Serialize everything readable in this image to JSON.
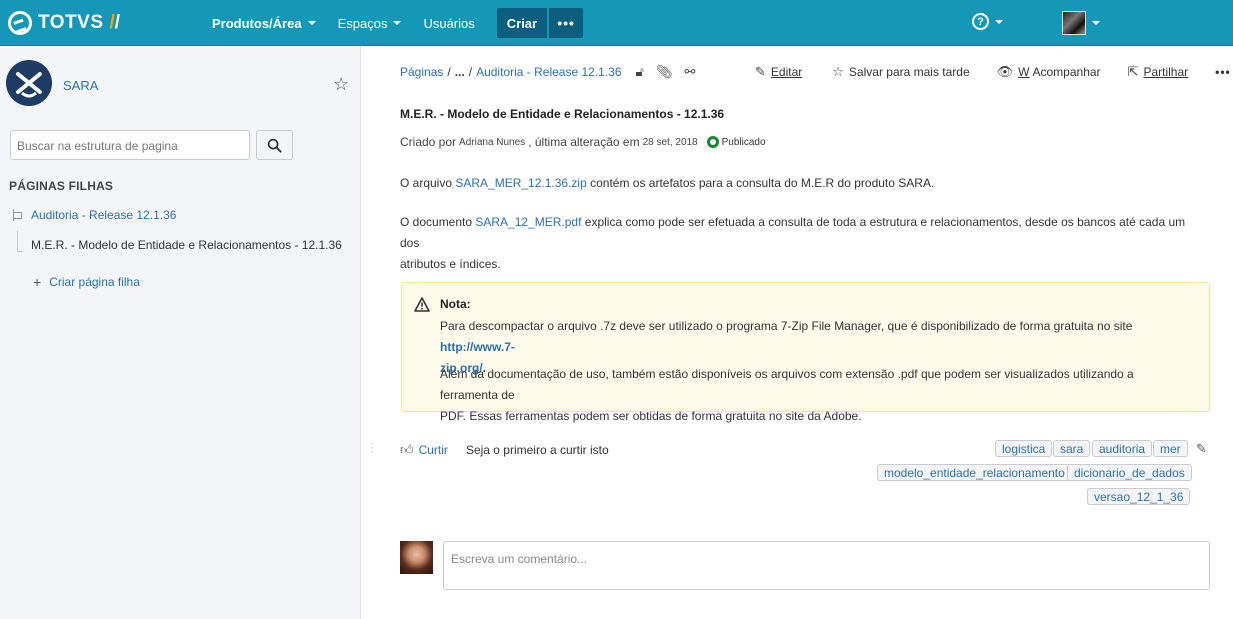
{
  "header": {
    "brand": "TOTVS",
    "brand_slash_1": "/",
    "brand_slash_2": "/",
    "nav": [
      {
        "label": "Produtos/Área"
      },
      {
        "label": "Espaços"
      },
      {
        "label": "Usuários"
      }
    ],
    "create_label": "Criar",
    "more_label": "•••",
    "help_symbol": "?",
    "colors": {
      "topbar": "#1597b8",
      "create": "#0b5e7e",
      "brand_accent": "#f7a600"
    }
  },
  "sidebar": {
    "space_name": "SARA",
    "search_placeholder": "Buscar na estrutura de pagina",
    "child_pages_heading": "PÁGINAS FILHAS",
    "parent_page": "Auditoria - Release 12.1.36",
    "current_page": "M.E.R. - Modelo de Entidade e Relacionamentos - 12.1.36",
    "create_child_label": "Criar página filha"
  },
  "breadcrumb": {
    "root": "Páginas",
    "ellipsis": "...",
    "parent": "Auditoria - Release 12.1.36"
  },
  "actions": {
    "edit": "Editar",
    "save_later": "Salvar para mais tarde",
    "watch_shortcut": "W",
    "watch": "Acompanhar",
    "share": "Partilhar",
    "more": "•••"
  },
  "page": {
    "title": "M.E.R. - Modelo de Entidade e Relacionamentos - 12.1.36",
    "meta_prefix": "Criado por",
    "meta_author": "Adriana Nunes",
    "meta_middle": ", última alteração em",
    "meta_date": "28 set, 2018",
    "status": "Publicado",
    "para1": {
      "before": "O arquivo ",
      "link": "SARA_MER_12.1.36.zip",
      "after": " contém os artefatos para a consulta do M.E.R do produto SARA."
    },
    "para2": {
      "before": "O documento ",
      "link": "SARA_12_MER.pdf",
      "after_line1": " explica como pode ser efetuada a consulta de toda a estrutura e relacionamentos, desde os bancos até cada um dos",
      "line2": "atributos e índices."
    },
    "note": {
      "title": "Nota:",
      "text1": "Para descompactar o arquivo .7z deve ser utilizado o programa 7-Zip File Manager, que é disponibilizado de forma gratuita no site ",
      "link_part1": "http://www.7-",
      "link_part2": "zip.org/",
      "text1_end": ".",
      "text2_line1": "Além da documentação de uso, também estão disponíveis os arquivos com extensão .pdf que podem ser visualizados utilizando a ferramenta de",
      "text2_line2": "PDF. Essas ferramentas podem ser obtidas de forma gratuita no site da Adobe."
    }
  },
  "likes": {
    "like_label": "Curtir",
    "text": "Seja o primeiro a curtir isto"
  },
  "labels": [
    "logistica",
    "sara",
    "auditoria",
    "mer",
    "modelo_entidade_relacionamento",
    "dicionario_de_dados",
    "versao_12_1_36"
  ],
  "comment": {
    "placeholder": "Escreva um comentário..."
  }
}
